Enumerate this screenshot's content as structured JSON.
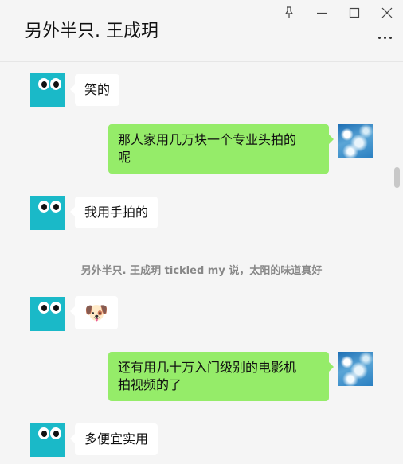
{
  "window": {
    "title": "另外半只. 王成玥",
    "controls": {
      "pin_icon": "pin-icon",
      "minimize_icon": "minimize-icon",
      "maximize_icon": "maximize-icon",
      "close_icon": "close-icon"
    },
    "more_icon": "more-dots-icon"
  },
  "colors": {
    "background": "#f5f5f5",
    "self_bubble": "#95ec69",
    "other_bubble": "#ffffff",
    "avatar_teal": "#1ab9c8",
    "system_text": "#888888"
  },
  "messages": [
    {
      "sender": "other",
      "text": "笑的"
    },
    {
      "sender": "self",
      "text": "那人家用几万块一个专业头拍的呢"
    },
    {
      "sender": "other",
      "text": "我用手拍的"
    },
    {
      "type": "system",
      "text": "另外半只. 王成玥 tickled my  说，太阳的味道真好"
    },
    {
      "sender": "other",
      "emoji": "🐶"
    },
    {
      "sender": "self",
      "text": "还有用几十万入门级别的电影机拍视频的了"
    },
    {
      "sender": "other",
      "text": "多便宜实用"
    }
  ],
  "text_lines": {
    "m1": "那人家用几万块一个专业头拍的",
    "m1b": "呢",
    "m5": "还有用几十万入门级别的电影机",
    "m5b": "拍视频的了"
  }
}
